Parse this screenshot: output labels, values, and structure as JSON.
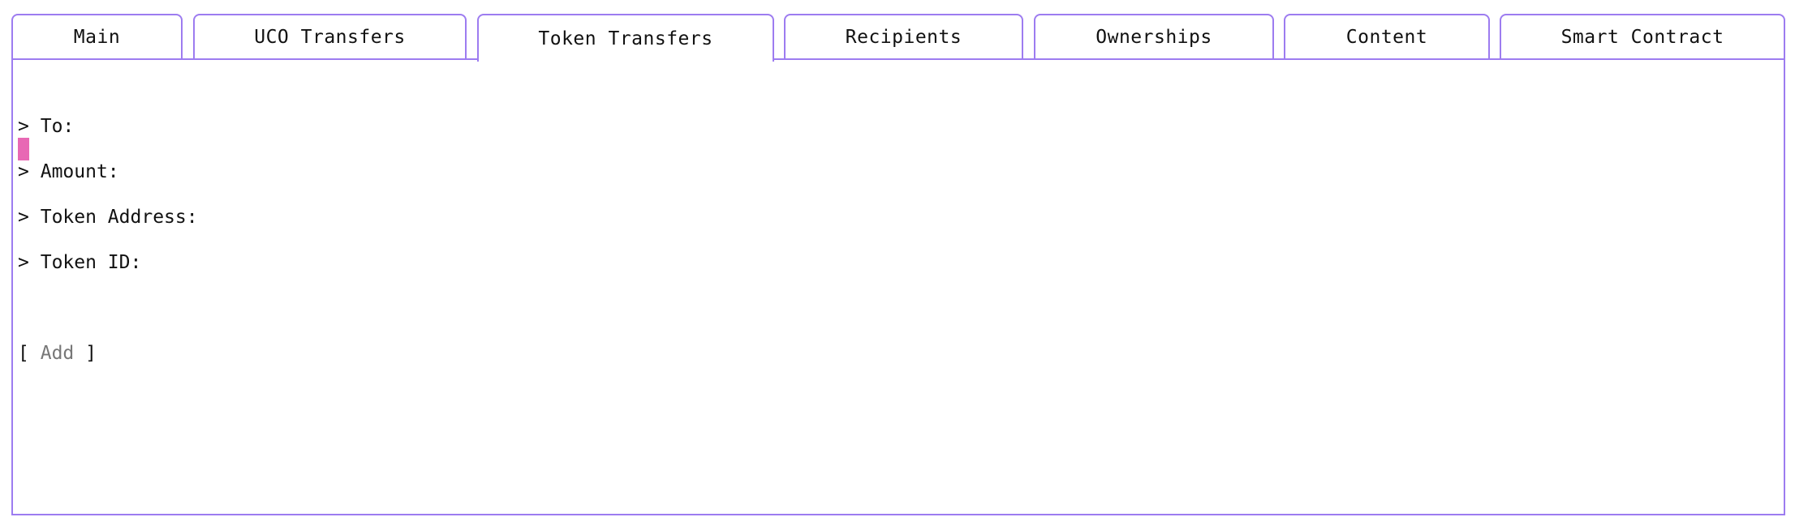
{
  "tabs": [
    {
      "label": "Main"
    },
    {
      "label": "UCO Transfers"
    },
    {
      "label": "Token Transfers",
      "active": true
    },
    {
      "label": "Recipients"
    },
    {
      "label": "Ownerships"
    },
    {
      "label": "Content"
    },
    {
      "label": "Smart Contract"
    }
  ],
  "form": {
    "prompt": ">",
    "to_label": "To:",
    "amount_label": "Amount:",
    "token_address_label": "Token Address:",
    "token_id_label": "Token ID:"
  },
  "add_button": {
    "open": "[",
    "label": "Add",
    "close": "]"
  },
  "colors": {
    "accent_border": "#9d7cf0",
    "cursor": "#e868b4",
    "muted_text": "#777777"
  }
}
